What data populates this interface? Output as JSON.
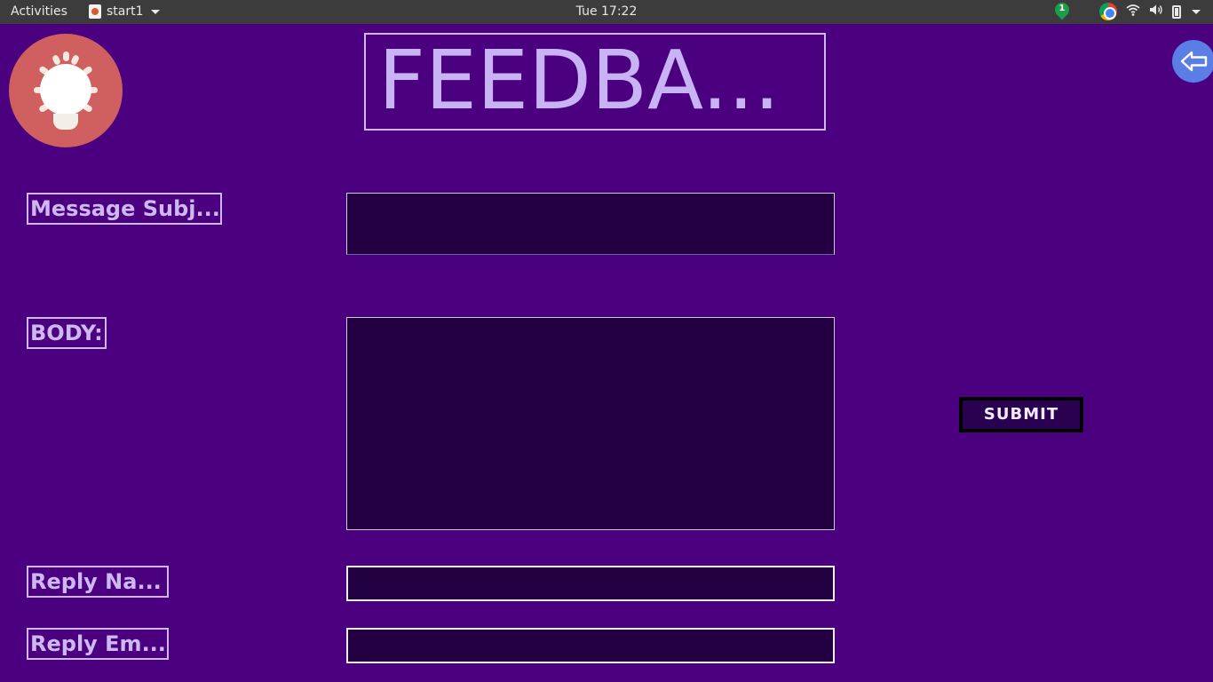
{
  "topbar": {
    "activities": "Activities",
    "app_name": "start1",
    "clock": "Tue 17:22",
    "notification_count": "1"
  },
  "app": {
    "title": "FEEDBA...",
    "labels": {
      "subject": "Message Subj...",
      "body": "BODY:",
      "reply_name": "Reply Na...",
      "reply_email": "Reply Em..."
    },
    "fields": {
      "subject": "",
      "body": "",
      "reply_name": "",
      "reply_email": ""
    },
    "submit_label": "SUBMIT"
  },
  "icons": {
    "logo": "lightbulb-icon",
    "back": "back-arrow-icon"
  },
  "colors": {
    "background": "#4b0080",
    "field_fill": "#230042",
    "label_text": "#cdb9f0",
    "logo_circle": "#d06060",
    "back_button": "#5a7ee6"
  }
}
